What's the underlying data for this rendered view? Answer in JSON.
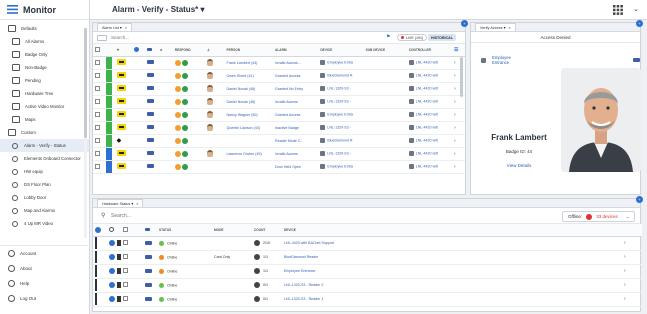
{
  "app": {
    "title": "Monitor"
  },
  "sidebar": {
    "items": [
      {
        "label": "Defaults",
        "icon": "folder-icon",
        "sub": false
      },
      {
        "label": "All Alarms",
        "icon": "alarm-icon",
        "sub": true
      },
      {
        "label": "Badge Only",
        "icon": "badge-icon",
        "sub": true
      },
      {
        "label": "Non-Badge",
        "icon": "non-badge-icon",
        "sub": true
      },
      {
        "label": "Pending",
        "icon": "diamond-icon",
        "sub": true
      },
      {
        "label": "Hardware Tree",
        "icon": "hardware-icon",
        "sub": true
      },
      {
        "label": "Active Video Monitor",
        "icon": "video-icon",
        "sub": true
      },
      {
        "label": "Maps",
        "icon": "map-icon",
        "sub": true
      },
      {
        "label": "Custom",
        "icon": "custom-icon",
        "sub": false
      },
      {
        "label": "Alarm - Verify - Status",
        "icon": "layout-icon",
        "sub": true,
        "active": true
      },
      {
        "label": "Elements Onboard Connector",
        "icon": "layout-icon",
        "sub": true
      },
      {
        "label": "HW equip",
        "icon": "layout-icon",
        "sub": true
      },
      {
        "label": "DS Floor Plan",
        "icon": "layout-icon",
        "sub": true
      },
      {
        "label": "Lobby Door",
        "icon": "layout-icon",
        "sub": true
      },
      {
        "label": "Map and Alarms",
        "icon": "layout-icon",
        "sub": true
      },
      {
        "label": "4 Up MR Video",
        "icon": "layout-icon",
        "sub": true
      }
    ],
    "footer": [
      {
        "label": "Account",
        "icon": "account-icon"
      },
      {
        "label": "About",
        "icon": "info-icon"
      },
      {
        "label": "Help",
        "icon": "help-icon"
      },
      {
        "label": "Log Out",
        "icon": "logout-icon"
      }
    ]
  },
  "header": {
    "page_title": "Alarm - Verify - Status* ▾",
    "chevron": "⌄"
  },
  "alarm_list": {
    "tab_label": "Alarm List ▾",
    "close": "×",
    "add": "+",
    "search_placeholder": "Search...",
    "live_label": "LIVE (191)",
    "historical_label": "HISTORICAL",
    "columns": [
      "",
      "",
      "",
      "",
      "",
      "",
      "RESPOND",
      "",
      "PERSON",
      "ALARM",
      "DEVICE",
      "SUB DEVICE",
      "CONTROLLER",
      ""
    ],
    "rows": [
      {
        "sev": "#3cb44b",
        "sev_flag": "",
        "person": "Frank Lambert (44)",
        "alarm": "Invalid Access...",
        "device": "Employee Entra",
        "controller": "LNL-4420 witt"
      },
      {
        "sev": "#3cb44b",
        "sev_flag": "",
        "person": "Owen Sherit (41)",
        "alarm": "Granted Access",
        "device": "BlueDiamond R",
        "controller": "LNL-4420 witt"
      },
      {
        "sev": "#3cb44b",
        "sev_flag": "",
        "person": "Daniel Novak (46)",
        "alarm": "Granted No Entry",
        "device": "LNL-1320-S3 -",
        "controller": "LNL-4420 witt"
      },
      {
        "sev": "#3cb44b",
        "sev_flag": "",
        "person": "Daniel Novak (46)",
        "alarm": "Invalid Access",
        "device": "LNL-1320-S3 -",
        "controller": "LNL-4420 witt"
      },
      {
        "sev": "#3cb44b",
        "sev_flag": "",
        "person": "Nancy Wagner (50)",
        "alarm": "Granted Access",
        "device": "Employee Entra",
        "controller": "LNL-4420 witt"
      },
      {
        "sev": "#3cb44b",
        "sev_flag": "",
        "person": "Quentin Lawson (43)",
        "alarm": "Inactive Badge",
        "device": "LNL-1320-S3 -",
        "controller": "LNL-4420 witt"
      },
      {
        "sev": "#3cb44b",
        "sev_flag": "diamond",
        "person": "",
        "alarm": "Reader Mode C...",
        "device": "BlueDiamond R",
        "controller": "LNL-4420 witt"
      },
      {
        "sev": "#2e6fd3",
        "sev_flag": "",
        "person": "Lawrence Gruber (45)",
        "alarm": "Invalid Access",
        "device": "LNL-1320-S3 -",
        "controller": "LNL-4420 witt"
      },
      {
        "sev": "#2e6fd3",
        "sev_flag": "",
        "person": "",
        "alarm": "Door Held Open",
        "device": "Employee Entra",
        "controller": "LNL-4420 witt"
      }
    ]
  },
  "verify": {
    "tab_label": "Verify Access ▾",
    "close": "×",
    "status": "Access Denied",
    "door": "Employee Entrance",
    "name": "Frank Lambert",
    "badge": "Badge ID: 44",
    "link": "View Details"
  },
  "hardware": {
    "tab_label": "Hardware Status ▾",
    "close": "×",
    "add": "+",
    "search_placeholder": "Search...",
    "offline_prefix": "Offline:",
    "offline_count": "33 devices",
    "columns": [
      "",
      "",
      "",
      "",
      "STATUS",
      "MODE",
      "COUNT",
      "DEVICE",
      ""
    ],
    "rows": [
      {
        "status": "Online",
        "status_color": "#6cbf4b",
        "mode": "",
        "count": "2/10",
        "device": "LNL-4420 with BACnet Support"
      },
      {
        "status": "Online",
        "status_color": "#f08a24",
        "mode": "Card Only",
        "count": "1/1",
        "device": "BlueDiamond Reader"
      },
      {
        "status": "Online",
        "status_color": "#f08a24",
        "mode": "",
        "count": "1/1",
        "device": "Employee Entrance"
      },
      {
        "status": "Online",
        "status_color": "#6cbf4b",
        "mode": "",
        "count": "0/1",
        "device": "LNL-1320-S3 - Reader 2"
      },
      {
        "status": "Online",
        "status_color": "#6cbf4b",
        "mode": "",
        "count": "0/1",
        "device": "LNL-1320-S3 - Reader 1"
      }
    ]
  },
  "colors": {
    "accent": "#2e6fd3",
    "link": "#2f5fb3",
    "danger": "#dd3333"
  }
}
